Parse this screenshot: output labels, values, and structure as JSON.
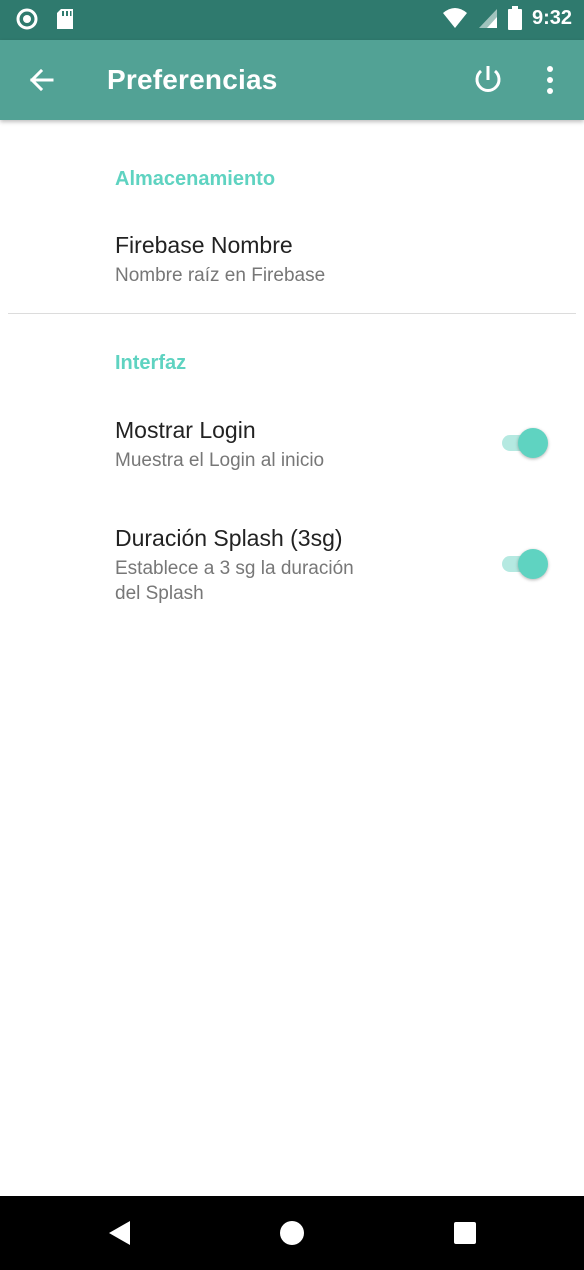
{
  "status_bar": {
    "time": "9:32",
    "icons_left": [
      "sync-circle-icon",
      "sd-card-icon"
    ],
    "icons_right": [
      "wifi-icon",
      "signal-icon",
      "battery-icon"
    ]
  },
  "app_bar": {
    "title": "Preferencias",
    "back_icon": "arrow-left-icon",
    "power_icon": "power-icon",
    "more_icon": "more-vert-icon",
    "color": "#52a295"
  },
  "sections": [
    {
      "category": "Almacenamiento",
      "items": [
        {
          "title": "Firebase Nombre",
          "summary": "Nombre raíz en Firebase"
        }
      ]
    },
    {
      "category": "Interfaz",
      "items": [
        {
          "title": "Mostrar Login",
          "summary": "Muestra el Login al inicio",
          "switch_on": true
        },
        {
          "title": "Duración Splash (3sg)",
          "summary_line1": "Establece a 3 sg la duración",
          "summary_line2": "del Splash",
          "switch_on": true
        }
      ]
    }
  ],
  "accent_color": "#5fd3c1",
  "nav_bar": {
    "icons": [
      "back-triangle-icon",
      "home-circle-icon",
      "recents-square-icon"
    ]
  }
}
